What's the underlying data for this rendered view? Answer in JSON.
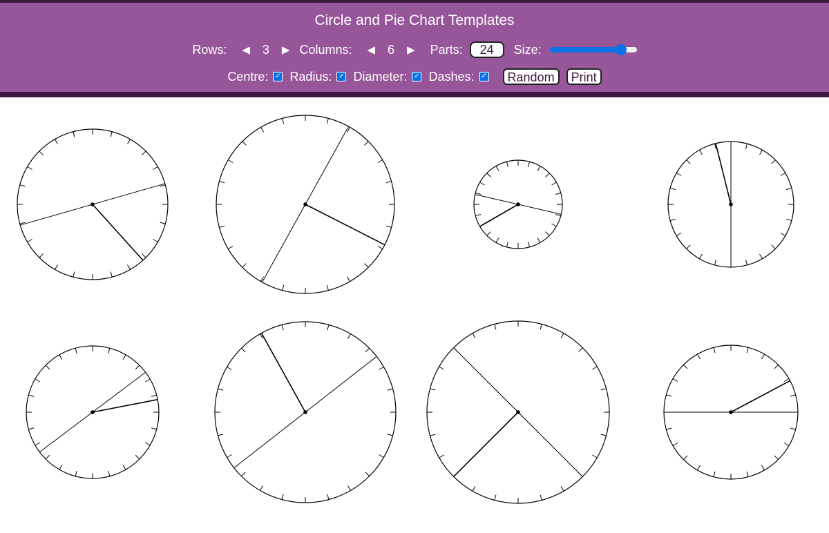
{
  "app": {
    "title": "Circle and Pie Chart Templates"
  },
  "controls": {
    "rows_label": "Rows:",
    "rows_value": "3",
    "columns_label": "Columns:",
    "columns_value": "6",
    "parts_label": "Parts:",
    "parts_value": "24",
    "size_label": "Size:",
    "size_fraction": 0.82,
    "prev_symbol": "◀",
    "next_symbol": "▶",
    "centre_label": "Centre:",
    "centre_checked": true,
    "radius_label": "Radius:",
    "radius_checked": true,
    "diameter_label": "Diameter:",
    "diameter_checked": true,
    "dashes_label": "Dashes:",
    "dashes_checked": true,
    "random_label": "Random",
    "print_label": "Print",
    "check_symbol": "✓"
  },
  "colors": {
    "header_bg": "#97559a",
    "header_border": "#3c1a3f",
    "accent": "#0a73e8",
    "stroke": "#000000"
  },
  "circles": [
    {
      "id": "circle-1",
      "diameter_angle": 74,
      "radius_angle": 138
    },
    {
      "id": "circle-2",
      "diameter_angle": 29,
      "radius_angle": 117
    },
    {
      "id": "circle-3",
      "diameter_angle": 283,
      "radius_angle": 240
    },
    {
      "id": "circle-4",
      "diameter_angle": 0,
      "radius_angle": 346
    },
    {
      "id": "circle-5",
      "diameter_angle": 53,
      "radius_angle": 79
    },
    {
      "id": "circle-6",
      "diameter_angle": 52,
      "radius_angle": 331
    },
    {
      "id": "circle-7",
      "diameter_angle": 315,
      "radius_angle": 225
    },
    {
      "id": "circle-8",
      "diameter_angle": 90,
      "radius_angle": 62
    }
  ]
}
